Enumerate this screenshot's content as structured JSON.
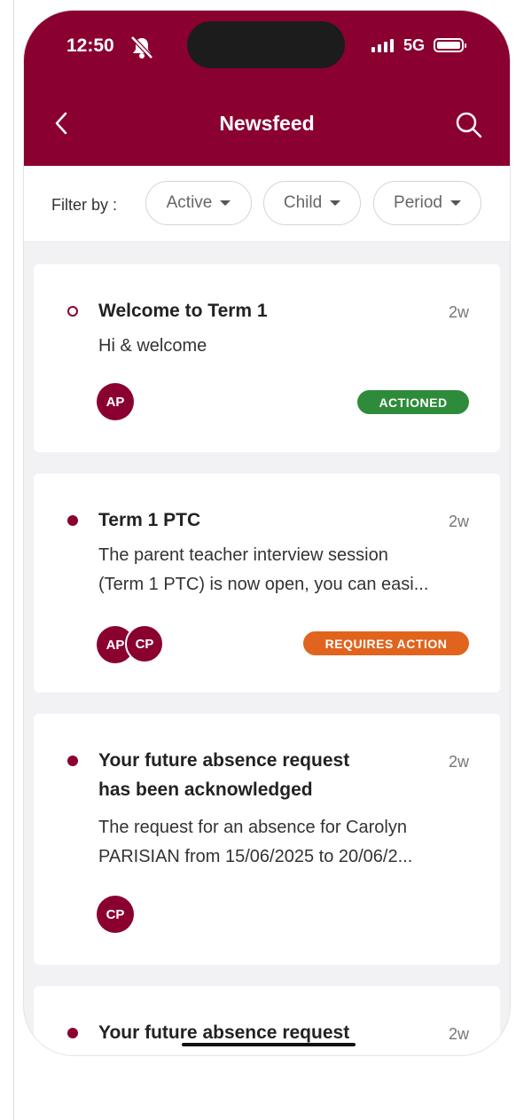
{
  "status_bar": {
    "time": "12:50",
    "network": "5G"
  },
  "header": {
    "title": "Newsfeed"
  },
  "filter": {
    "label": "Filter by :",
    "chips": [
      {
        "label": "Active"
      },
      {
        "label": "Child"
      },
      {
        "label": "Period"
      }
    ]
  },
  "feed": [
    {
      "title": "Welcome to Term 1",
      "time": "2w",
      "body": [
        "Hi & welcome"
      ],
      "read": true,
      "avatars": [
        "AP"
      ],
      "status": "ACTIONED",
      "status_color": "#2e8b3a"
    },
    {
      "title": "Term 1 PTC",
      "time": "2w",
      "body": [
        "The parent teacher interview session",
        "(Term 1 PTC) is now open, you can easi..."
      ],
      "read": false,
      "avatars": [
        "AP",
        "CP"
      ],
      "status": "REQUIRES ACTION",
      "status_color": "#e0641e"
    },
    {
      "title_lines": [
        "Your future absence request",
        "has been acknowledged"
      ],
      "time": "2w",
      "body": [
        "The request for an absence for Carolyn",
        "PARISIAN from 15/06/2025 to 20/06/2..."
      ],
      "read": false,
      "avatars": [
        "CP"
      ]
    },
    {
      "title": "Your future absence request",
      "time": "2w",
      "read": false
    }
  ],
  "colors": {
    "brand": "#8a0030",
    "background": "#f2f2f4"
  },
  "icons": {
    "back": "chevron-left-icon",
    "search": "search-icon",
    "silent": "bell-slash-icon",
    "dropdown": "caret-down-icon"
  }
}
